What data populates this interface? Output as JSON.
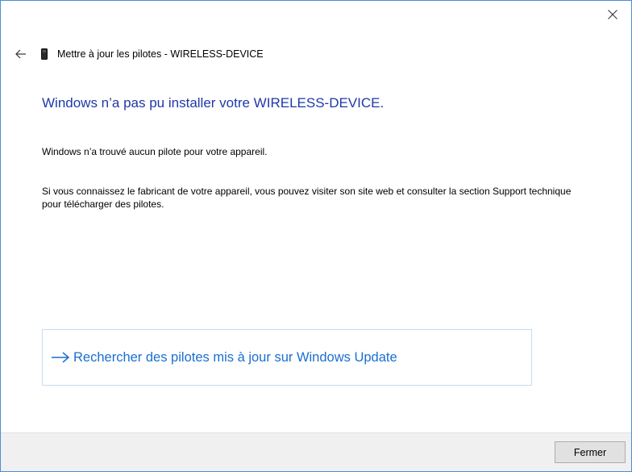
{
  "window": {
    "header_title": "Mettre à jour les pilotes - WIRELESS-DEVICE",
    "accent_border_color": "#4a8ed6"
  },
  "icons": {
    "close": "close-icon",
    "back": "back-arrow-icon",
    "device": "device-icon",
    "link_arrow": "arrow-right-icon"
  },
  "main": {
    "heading": "Windows n’a pas pu installer votre WIRELESS-DEVICE.",
    "heading_color": "#1e3aa8",
    "paragraph1": "Windows n’a trouvé aucun pilote pour votre appareil.",
    "paragraph2": "Si vous connaissez le fabricant de votre appareil, vous pouvez visiter son site web et consulter la section Support technique pour télécharger des pilotes."
  },
  "update_link": {
    "label": "Rechercher des pilotes mis à jour sur Windows Update",
    "color": "#1a6fd1"
  },
  "footer": {
    "close_button_label": "Fermer"
  }
}
